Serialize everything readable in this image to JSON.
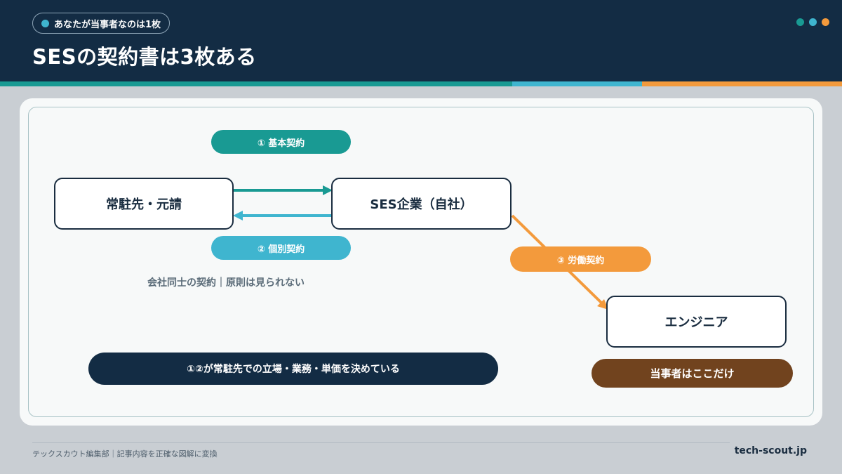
{
  "header": {
    "tag": "あなたが当事者なのは1枚",
    "title": "SESの契約書は3枚ある"
  },
  "nodes": {
    "client": "常駐先・元請",
    "ses": "SES企業（自社）",
    "engineer": "エンジニア"
  },
  "contracts": {
    "basic": "① 基本契約",
    "individual": "② 個別契約",
    "labor": "③ 労働契約"
  },
  "note": "会社同士の契約｜原則は見られない",
  "summary_bar": "①②が常駐先での立場・業務・単価を決めている",
  "badge": "当事者はここだけ",
  "footer": {
    "left": "テックスカウト編集部｜記事内容を正確な図解に変換",
    "right": "tech-scout.jp"
  },
  "colors": {
    "navy": "#132c44",
    "teal": "#199a93",
    "sky": "#3fb5cf",
    "orange": "#f39a3c",
    "brown": "#71431e"
  }
}
